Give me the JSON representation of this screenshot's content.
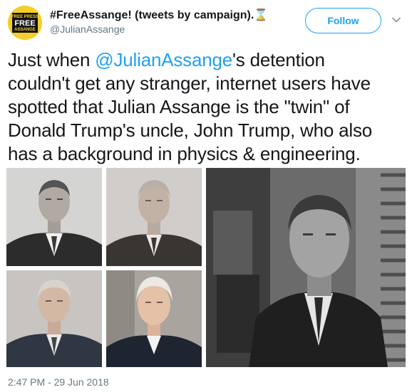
{
  "author": {
    "display_name": "#FreeAssange! (tweets by campaign).",
    "name_emoji": "⌛",
    "handle": "@JulianAssange",
    "avatar_text": [
      "FREE PRESS",
      "FREE",
      "ASSANGE"
    ]
  },
  "actions": {
    "follow_label": "Follow"
  },
  "tweet": {
    "line1_mention": "@JulianAssange",
    "line1_rest": "'s detention",
    "line1_prefix": "Just when ",
    "line2": "couldn't get any stranger, internet users have",
    "line3": "spotted that Julian Assange is the \"twin\" of",
    "line4": "Donald Trump's uncle, John Trump, who also",
    "line5": "has a background in physics & engineering.",
    "timestamp": "2:47 PM - 29 Jun 2018"
  },
  "media": {
    "photos": [
      "john-trump-portrait",
      "john-trump-assange-blend",
      "assange-blend-suit",
      "assange-portrait",
      "john-trump-lab-photo"
    ]
  },
  "colors": {
    "accent": "#1da1f2",
    "secondary_text": "#657786",
    "avatar_bg": "#f4cf2b"
  }
}
